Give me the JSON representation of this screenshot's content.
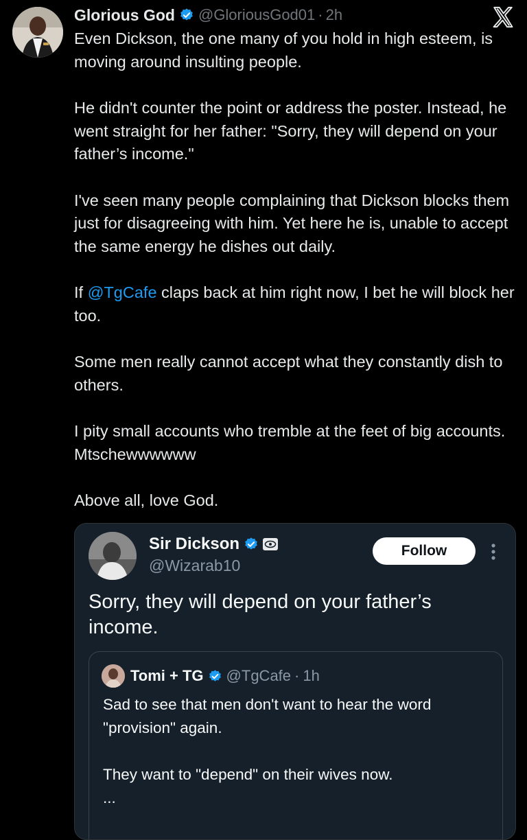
{
  "tweet": {
    "author_name": "Glorious God",
    "author_handle": "@GloriousGod01",
    "separator": "·",
    "time": "2h",
    "paragraphs": [
      "Even Dickson, the one many of you hold in high esteem, is moving around insulting people.",
      "He didn't counter the point or address the poster. Instead, he went straight for her father: \"Sorry, they will depend on your father’s income.\"",
      "I've seen many people complaining that Dickson blocks them just for disagreeing with him. Yet here he is, unable to accept the same energy he dishes out daily."
    ],
    "p4_before": "If ",
    "p4_mention": "@TgCafe",
    "p4_after": " claps back at him right now, I bet he will block her too.",
    "paragraphs_end": [
      "Some men really cannot accept what they constantly dish to others.",
      "I pity small accounts who tremble at the feet of big accounts. Mtschewwwwww",
      "Above all, love God."
    ]
  },
  "quoted": {
    "author_name": "Sir Dickson",
    "author_handle": "@Wizarab10",
    "follow_label": "Follow",
    "text": "Sorry, they will depend on your father’s income."
  },
  "nested": {
    "author_name": "Tomi + TG",
    "author_handle": "@TgCafe",
    "separator": "·",
    "time": "1h",
    "paragraphs": [
      "Sad to see that men don't want to hear the word \"provision\" again.",
      "They want to \"depend\" on their wives now.",
      "..."
    ]
  },
  "colors": {
    "background": "#000000",
    "card_background": "#15202b",
    "text": "#e7e9ea",
    "secondary_text": "#71767b",
    "link": "#1d9bf0",
    "verified": "#1d9bf0"
  },
  "icons": [
    "avatar",
    "verified-badge-icon",
    "x-logo-icon",
    "eye-badge-icon",
    "more-options-icon"
  ]
}
